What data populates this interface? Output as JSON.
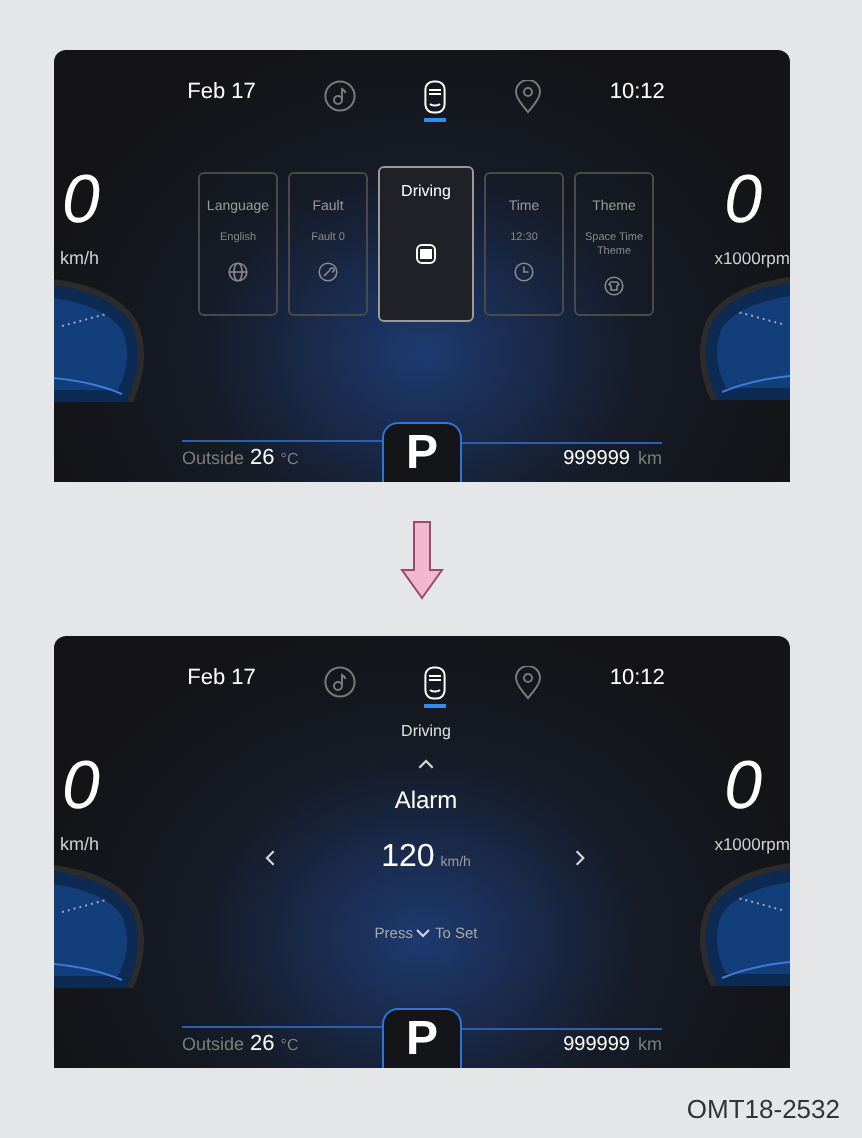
{
  "screens": [
    {
      "kind": "menu",
      "date": "Feb 17",
      "time": "10:12",
      "nav": [
        {
          "kind": "music",
          "selected": false
        },
        {
          "kind": "car",
          "selected": true
        },
        {
          "kind": "location",
          "selected": false
        }
      ],
      "speed": "0",
      "speed_unit": "km/h",
      "rpm": "0",
      "rpm_unit": "x1000rpm",
      "cards": [
        {
          "kind": "globe",
          "label": "Language",
          "value": "English",
          "selected": false
        },
        {
          "kind": "wrench",
          "label": "Fault",
          "value": "Fault 0",
          "selected": false
        },
        {
          "kind": "car",
          "label": "Driving",
          "selected": true
        },
        {
          "kind": "clock",
          "label": "Time",
          "value": "12:30",
          "selected": false
        },
        {
          "kind": "shirt",
          "label": "Theme",
          "value": "Space Time Theme",
          "selected": false
        }
      ],
      "outside_label": "Outside",
      "temp": "26",
      "temp_unit": "°C",
      "gear": "P",
      "odometer": "999999",
      "odometer_unit": "km"
    },
    {
      "kind": "setting",
      "date": "Feb 17",
      "time": "10:12",
      "nav": [
        {
          "kind": "music",
          "selected": false
        },
        {
          "kind": "car",
          "selected": true
        },
        {
          "kind": "location",
          "selected": false
        }
      ],
      "speed": "0",
      "speed_unit": "km/h",
      "rpm": "0",
      "rpm_unit": "x1000rpm",
      "setting": {
        "title": "Driving",
        "name": "Alarm",
        "value": "120",
        "unit": "km/h",
        "hint_before": "Press",
        "hint_after": "To Set"
      },
      "outside_label": "Outside",
      "temp": "26",
      "temp_unit": "°C",
      "gear": "P",
      "odometer": "999999",
      "odometer_unit": "km"
    }
  ],
  "figure_id": "OMT18-2532"
}
